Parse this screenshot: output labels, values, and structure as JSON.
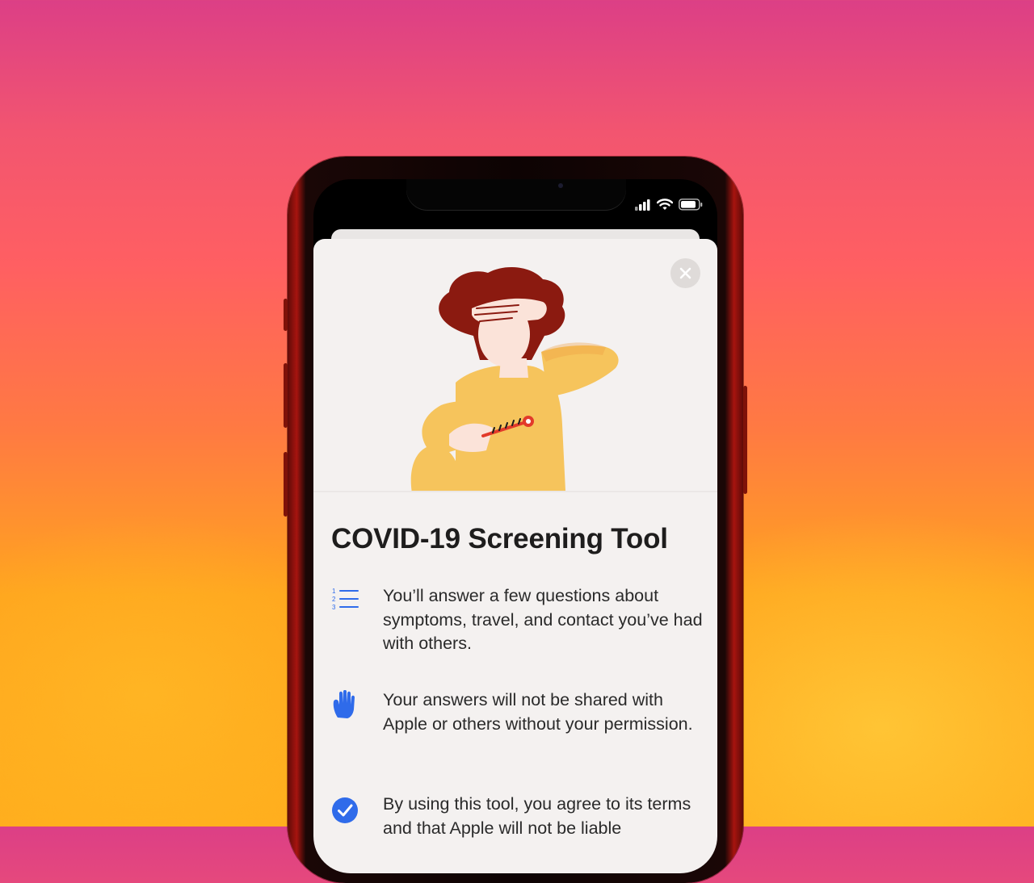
{
  "screen": {
    "title": "COVID-19 Screening Tool",
    "items": [
      {
        "icon": "numbered-list-icon",
        "text": "You’ll answer a few questions about symptoms, travel, and contact you’ve had with others."
      },
      {
        "icon": "raised-hand-icon",
        "text": "Your answers will not be shared with Apple or others without your permission."
      },
      {
        "icon": "checkmark-circle-icon",
        "text": "By using this tool, you agree to its terms and that Apple will not be liable"
      }
    ],
    "close_icon": "close-icon",
    "hero_illustration": "person-with-thermometer-illustration"
  },
  "status_bar": {
    "icons": [
      "cellular-signal-icon",
      "wifi-icon",
      "battery-icon"
    ]
  },
  "colors": {
    "accent": "#2f6bea",
    "sheet_background": "#f4f1f0",
    "title_text": "#1e1d1d",
    "illustration_hair": "#8b1a10",
    "illustration_sweater": "#f6c45c",
    "illustration_skin": "#fbe3d9",
    "thermometer": "#e23a2a"
  }
}
